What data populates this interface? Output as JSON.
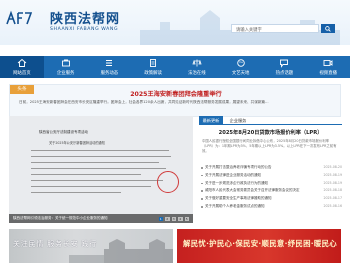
{
  "header": {
    "logo_cn": "陕西法帮网",
    "logo_en": "SHAANXI FABANG WANG",
    "search_placeholder": "请输入关键字",
    "search_icon": "search-icon"
  },
  "nav": {
    "items": [
      {
        "label": "网站首页",
        "icon": "home-icon",
        "active": true
      },
      {
        "label": "企业服务",
        "icon": "briefcase-icon"
      },
      {
        "label": "服务动态",
        "icon": "list-icon"
      },
      {
        "label": "政策解读",
        "icon": "document-icon"
      },
      {
        "label": "法治在线",
        "icon": "scales-icon"
      },
      {
        "label": "文艺天地",
        "icon": "art-icon"
      },
      {
        "label": "热点话题",
        "icon": "chat-icon"
      },
      {
        "label": "视频直播",
        "icon": "video-icon"
      }
    ]
  },
  "headline": {
    "ribbon": "头条",
    "title": "2025王海安新春团拜会隆重举行",
    "text": "日前，2025王海安新春团拜会在西安市长安区隆重举行。团拜会上，社会各界120余人出席，共同见证新时代陕西法帮服务发展成果，展望未来、共谋新篇…"
  },
  "photo": {
    "doc_title": "陕西省公安厅法制建设专项活动",
    "doc_sub": "关于2025年公安厅新春团拜活动的通知",
    "caption": "陕西法帮网引领法治服务：关于统一规范中小企业服务的通知",
    "dots": [
      "1",
      "2",
      "3",
      "4",
      "5"
    ],
    "active_dot": 0
  },
  "news": {
    "tabs": [
      "最新更新",
      "企业服务"
    ],
    "title": "2025年8月20日贷款市场报价利率（LPR）",
    "summary": "中国人民银行授权全国银行间同业拆借中心公布，2025年8月20日贷款市场报价利率（LPR）为：1年期LPR为3%，5年期以上LPR为3.5%。以上LPR在下一次发布LPR之前有效。",
    "items": [
      {
        "title": "关于开展打击整治养老诈骗专项行动的公告",
        "date": "2025-08-20"
      },
      {
        "title": "关于开展法律进企业服务活动的通知",
        "date": "2025-08-19"
      },
      {
        "title": "关于进一步规范涉企行政执法行为的通知",
        "date": "2025-08-19"
      },
      {
        "title": "咸阳市人民代表大会常务委员会关于召开法律服务会议的决定",
        "date": "2025-08-18"
      },
      {
        "title": "关于做好重要安全生产事故法律援助的通知",
        "date": "2025-08-17"
      },
      {
        "title": "关于开展助个人养老金服务试点的通知",
        "date": "2025-08-16"
      }
    ]
  },
  "banners": {
    "left": "关注民情 服务长安 践行",
    "right": "解民忧·护民心·保民安·顺民意·纾民困·暖民心"
  },
  "colors": {
    "brand": "#1d6cb3",
    "nav_active": "#0d4f8e",
    "headline_red": "#c01d1d",
    "ribbon": "#e8a03a"
  }
}
